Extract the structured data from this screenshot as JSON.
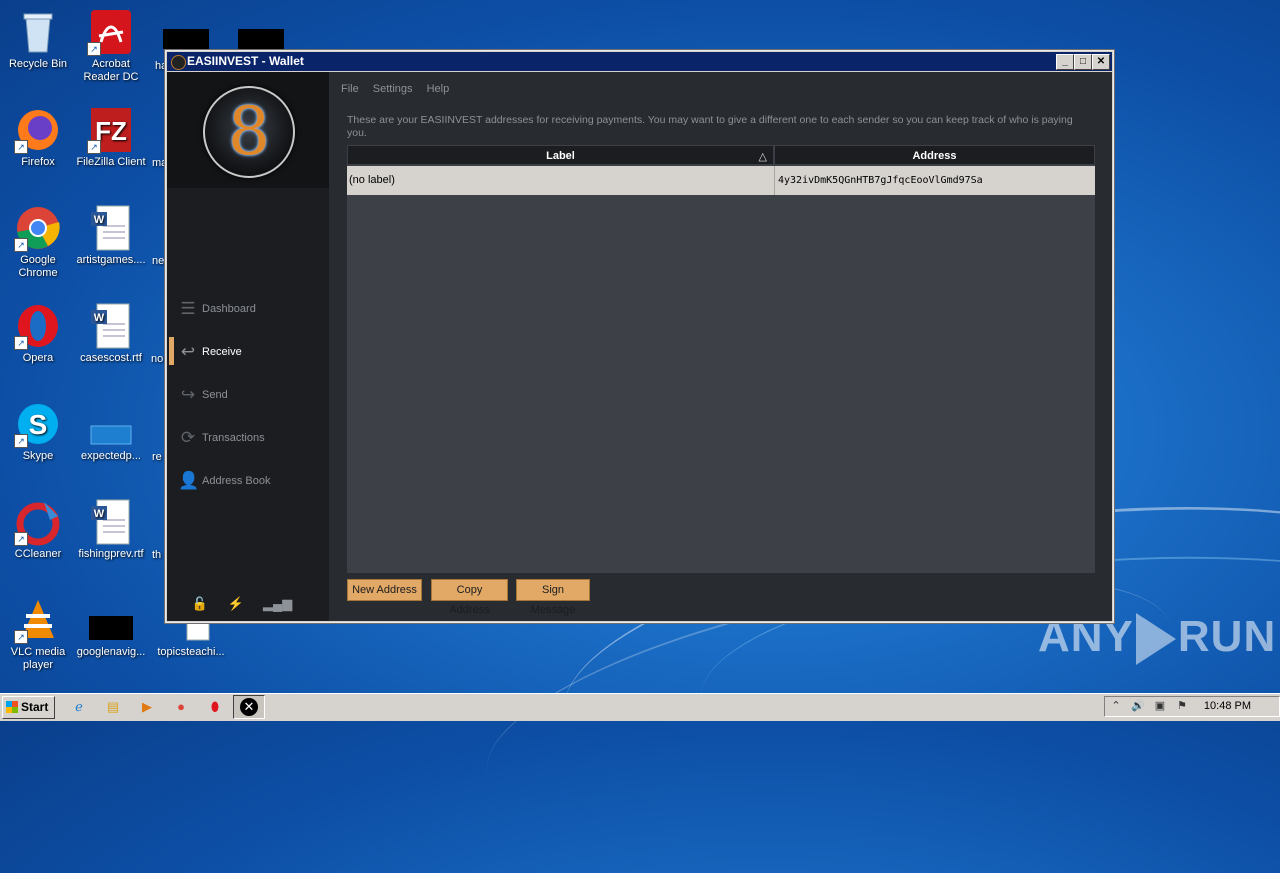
{
  "desktop": {
    "icons": [
      {
        "label": "Recycle Bin",
        "icon": "recycle-bin-icon"
      },
      {
        "label": "Acrobat Reader DC",
        "icon": "acrobat-icon"
      },
      {
        "label": "Firefox",
        "icon": "firefox-icon"
      },
      {
        "label": "FileZilla Client",
        "icon": "filezilla-icon"
      },
      {
        "label": "Google Chrome",
        "icon": "chrome-icon"
      },
      {
        "label": "artistgames....",
        "icon": "word-document-icon"
      },
      {
        "label": "Opera",
        "icon": "opera-icon"
      },
      {
        "label": "casescost.rtf",
        "icon": "word-document-icon"
      },
      {
        "label": "Skype",
        "icon": "skype-icon"
      },
      {
        "label": "expectedp...",
        "icon": "file-icon"
      },
      {
        "label": "CCleaner",
        "icon": "ccleaner-icon"
      },
      {
        "label": "fishingprev.rtf",
        "icon": "word-document-icon"
      },
      {
        "label": "VLC media player",
        "icon": "vlc-icon"
      },
      {
        "label": "googlenavig...",
        "icon": "file-icon"
      },
      {
        "label": "topicsteachi...",
        "icon": "file-icon"
      }
    ],
    "cut_labels": [
      "ha",
      "ma",
      "ne",
      "no",
      "re",
      "th"
    ]
  },
  "window": {
    "title": "EASIINVEST - Wallet",
    "controls": [
      "_",
      "□",
      "✕"
    ]
  },
  "sidebar": {
    "logo_glyph": "8",
    "nav": [
      {
        "label": "Dashboard",
        "icon": "dashboard-icon",
        "active": false
      },
      {
        "label": "Receive",
        "icon": "receive-icon",
        "active": true
      },
      {
        "label": "Send",
        "icon": "send-icon",
        "active": false
      },
      {
        "label": "Transactions",
        "icon": "transactions-icon",
        "active": false
      },
      {
        "label": "Address Book",
        "icon": "address-book-icon",
        "active": false
      }
    ],
    "status_icons": [
      "lock-icon",
      "lightning-icon",
      "signal-icon"
    ]
  },
  "menu": [
    "File",
    "Settings",
    "Help"
  ],
  "receive": {
    "description": "These are your EASIINVEST addresses for receiving payments. You may want to give a different one to each sender so you can keep track of who is paying you.",
    "table": {
      "columns": [
        "Label",
        "Address"
      ],
      "rows": [
        {
          "label": "(no label)",
          "address": "4y32ivDmK5QGnHTB7gJfqcEooVlGmd97Sa"
        }
      ]
    },
    "buttons": {
      "new_address": "New Address",
      "copy_address": "Copy Address",
      "sign_message": "Sign Message"
    }
  },
  "watermark": {
    "left": "ANY",
    "right": "RUN"
  },
  "taskbar": {
    "start": "Start",
    "clock": "10:48 PM"
  },
  "colors": {
    "accent": "#e2a865",
    "sidebar_bg": "#1b1d20",
    "main_bg": "#282b30",
    "table_bg": "#3d4047",
    "titlebar": "#0a246a"
  }
}
